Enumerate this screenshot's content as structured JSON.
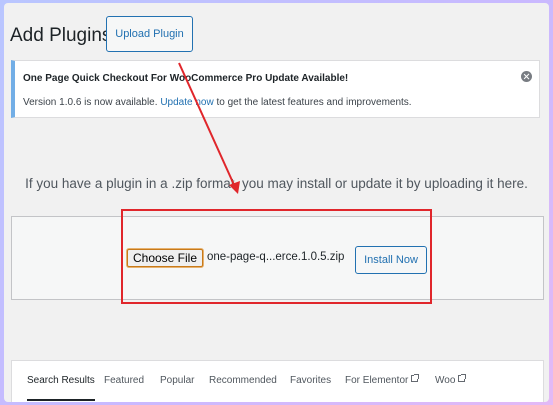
{
  "header": {
    "title": "Add Plugins",
    "upload_button": "Upload Plugin"
  },
  "notice": {
    "title": "One Page Quick Checkout For WooCommerce Pro Update Available!",
    "body_prefix": "Version 1.0.6 is now available. ",
    "link_text": "Update now",
    "body_suffix": " to get the latest features and improvements."
  },
  "upload": {
    "help_text": "If you have a plugin in a .zip format, you may install or update it by uploading it here.",
    "choose_file_label": "Choose File",
    "file_name": "one-page-q...erce.1.0.5.zip",
    "install_button": "Install Now"
  },
  "filter_tabs": [
    {
      "label": "Search Results",
      "active": true,
      "external": false
    },
    {
      "label": "Featured",
      "active": false,
      "external": false
    },
    {
      "label": "Popular",
      "active": false,
      "external": false
    },
    {
      "label": "Recommended",
      "active": false,
      "external": false
    },
    {
      "label": "Favorites",
      "active": false,
      "external": false
    },
    {
      "label": "For Elementor",
      "active": false,
      "external": true
    },
    {
      "label": "Woo",
      "active": false,
      "external": true
    }
  ],
  "colors": {
    "accent": "#2271b1",
    "annotation": "#e0262b",
    "notice_border": "#72aee6"
  },
  "icons": {
    "dismiss": "close-circle-icon",
    "external": "external-link-icon",
    "annotation_arrow": "arrow-icon"
  }
}
